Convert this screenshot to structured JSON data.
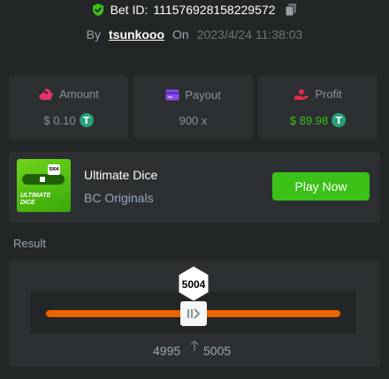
{
  "header": {
    "bet_id_prefix": "Bet ID:",
    "bet_id": "111576928158229572",
    "by_label": "By",
    "username": "tsunkooo",
    "on_label": "On",
    "timestamp": "2023/4/24 11:38:03"
  },
  "stats": {
    "amount_label": "Amount",
    "amount_value": "$ 0.10",
    "payout_label": "Payout",
    "payout_value": "900 x",
    "profit_label": "Profit",
    "profit_value": "$ 89.98",
    "currency_glyph": "T"
  },
  "game": {
    "name": "Ultimate Dice",
    "provider": "BC Originals",
    "thumb_text": "ULTIMATE DICE",
    "thumb_badge": "5004",
    "play_label": "Play Now"
  },
  "result": {
    "label": "Result",
    "roll": "5004",
    "range_low": "4995",
    "range_high": "5005"
  },
  "colors": {
    "background": "#232626",
    "panel": "#2d3032",
    "accent_green": "#3bc117",
    "track_orange": "#ed6300",
    "usdt": "#26a17b"
  }
}
